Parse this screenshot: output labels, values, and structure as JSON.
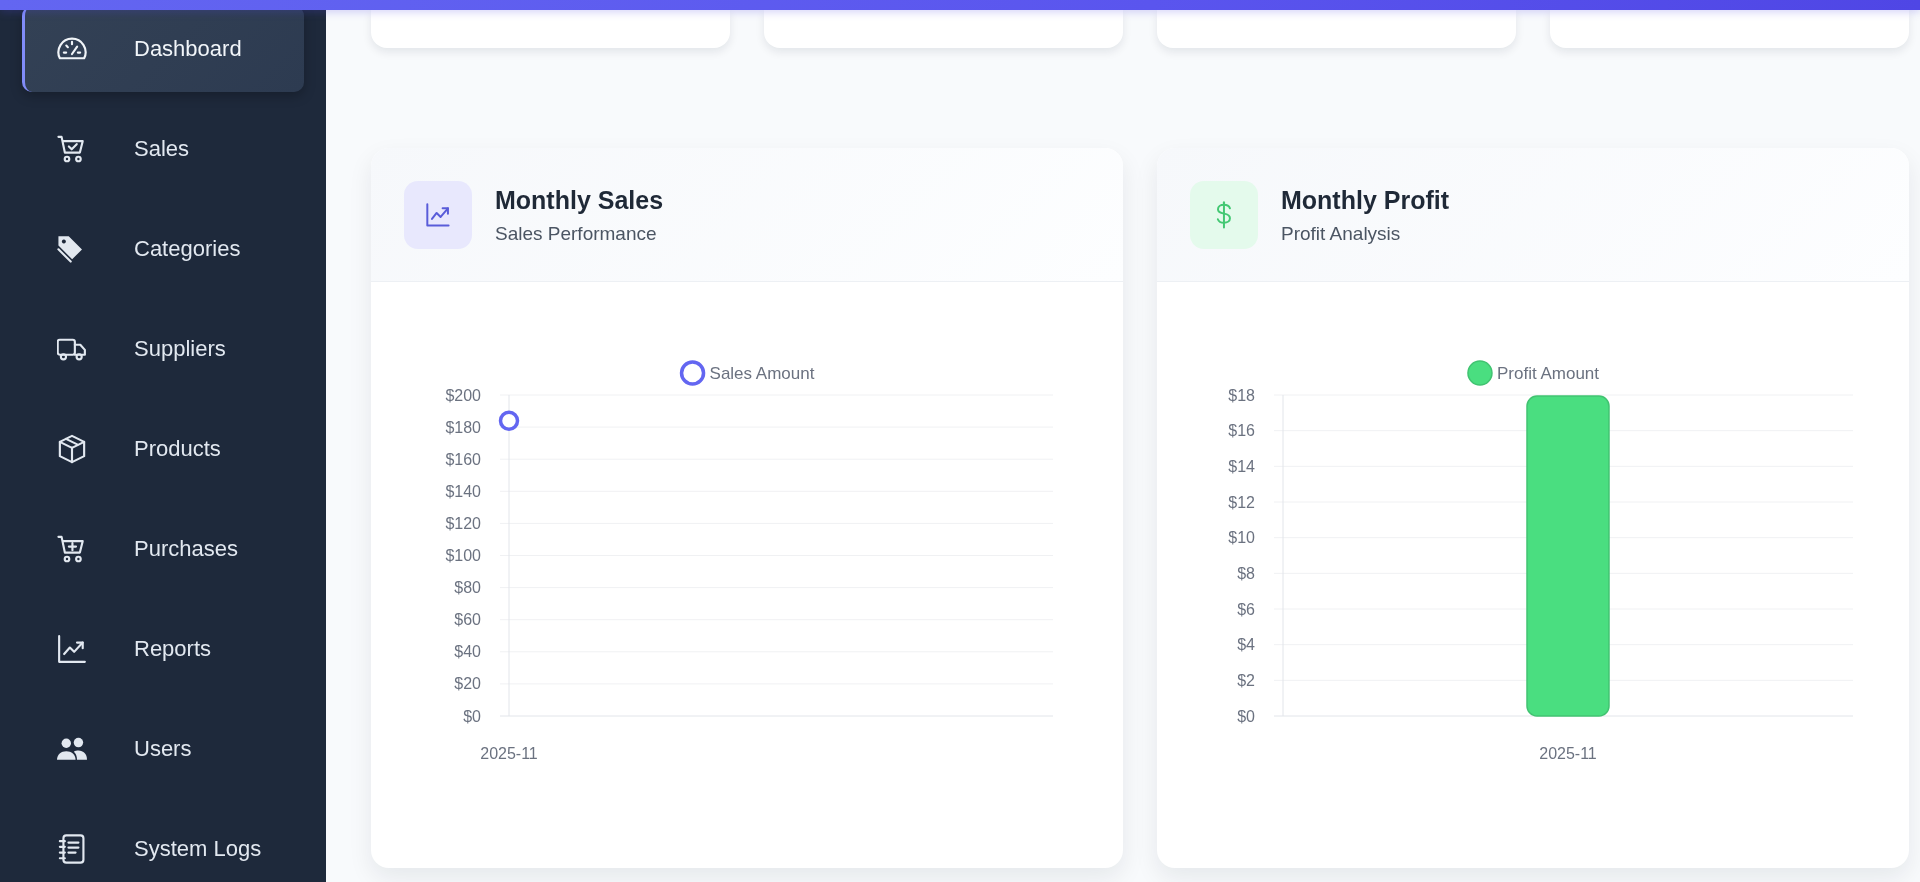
{
  "sidebar": {
    "items": [
      {
        "label": "Dashboard",
        "selected": true
      },
      {
        "label": "Sales",
        "selected": false
      },
      {
        "label": "Categories",
        "selected": false
      },
      {
        "label": "Suppliers",
        "selected": false
      },
      {
        "label": "Products",
        "selected": false
      },
      {
        "label": "Purchases",
        "selected": false
      },
      {
        "label": "Reports",
        "selected": false
      },
      {
        "label": "Users",
        "selected": false
      },
      {
        "label": "System Logs",
        "selected": false
      }
    ]
  },
  "stat_cards": [
    {
      "partly_hidden": true
    },
    {
      "partly_hidden": true
    },
    {
      "partly_hidden": true
    },
    {
      "partly_hidden": true
    }
  ],
  "chart_cards": [
    {
      "title": "Monthly Sales",
      "subtitle": "Sales Performance",
      "chart_data": {
        "type": "line",
        "grid": true,
        "categories": [
          "2025-11"
        ],
        "series": [
          {
            "name": "Sales Amount",
            "color": "#6366f1",
            "marker": "circle",
            "values": [
              184
            ]
          }
        ],
        "ylim": [
          0,
          200
        ],
        "yticks": [
          {
            "value": 0,
            "label": "$0"
          },
          {
            "value": 20,
            "label": "$20"
          },
          {
            "value": 40,
            "label": "$40"
          },
          {
            "value": 60,
            "label": "$60"
          },
          {
            "value": 80,
            "label": "$80"
          },
          {
            "value": 100,
            "label": "$100"
          },
          {
            "value": 120,
            "label": "$120"
          },
          {
            "value": 140,
            "label": "$140"
          },
          {
            "value": 160,
            "label": "$160"
          },
          {
            "value": 180,
            "label": "$180"
          },
          {
            "value": 200,
            "label": "$200"
          }
        ]
      }
    },
    {
      "title": "Monthly Profit",
      "subtitle": "Profit Analysis",
      "chart_data": {
        "type": "bar",
        "grid": true,
        "categories": [
          "2025-11"
        ],
        "series": [
          {
            "name": "Profit Amount",
            "color": "#4ade80",
            "values": [
              18
            ]
          }
        ],
        "ylim": [
          0,
          18
        ],
        "yticks": [
          {
            "value": 0,
            "label": "$0"
          },
          {
            "value": 2,
            "label": "$2"
          },
          {
            "value": 4,
            "label": "$4"
          },
          {
            "value": 6,
            "label": "$6"
          },
          {
            "value": 8,
            "label": "$8"
          },
          {
            "value": 10,
            "label": "$10"
          },
          {
            "value": 12,
            "label": "$12"
          },
          {
            "value": 14,
            "label": "$14"
          },
          {
            "value": 16,
            "label": "$16"
          },
          {
            "value": 18,
            "label": "$18"
          }
        ]
      }
    }
  ]
}
